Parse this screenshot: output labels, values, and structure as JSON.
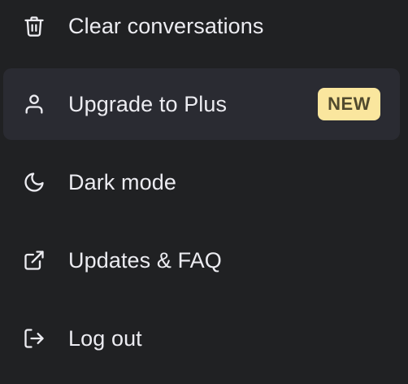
{
  "menu": {
    "items": [
      {
        "icon": "trash-icon",
        "label": "Clear conversations"
      },
      {
        "icon": "user-icon",
        "label": "Upgrade to Plus",
        "badge": "NEW"
      },
      {
        "icon": "moon-icon",
        "label": "Dark mode"
      },
      {
        "icon": "external-link-icon",
        "label": "Updates & FAQ"
      },
      {
        "icon": "log-out-icon",
        "label": "Log out"
      }
    ]
  },
  "colors": {
    "background": "#202123",
    "active_row": "#2a2b32",
    "text": "#ececf1",
    "badge_bg": "#fae69e",
    "badge_text": "#514a2e"
  }
}
